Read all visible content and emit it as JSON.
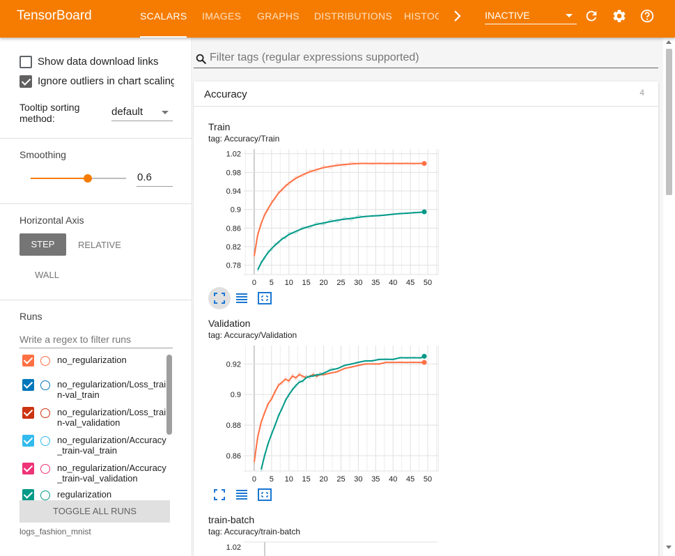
{
  "app": {
    "title": "TensorBoard"
  },
  "tabs": [
    {
      "label": "SCALARS",
      "active": true
    },
    {
      "label": "IMAGES"
    },
    {
      "label": "GRAPHS"
    },
    {
      "label": "DISTRIBUTIONS"
    },
    {
      "label": "HISTOG"
    }
  ],
  "status": {
    "value": "INACTIVE"
  },
  "icons": {
    "more_tabs": "chevron-right-icon",
    "reload": "reload-icon",
    "settings": "gear-icon",
    "help": "help-icon"
  },
  "sidebar": {
    "show_download": "Show data download links",
    "ignore_outliers": "Ignore outliers in chart scaling",
    "tooltip_label": "Tooltip sorting method:",
    "tooltip_value": "default",
    "smoothing_label": "Smoothing",
    "smoothing_value": "0.6",
    "smoothing_level": 0.6,
    "haxis_label": "Horizontal Axis",
    "haxis_step": "STEP",
    "haxis_relative": "RELATIVE",
    "haxis_wall": "WALL",
    "runs_label": "Runs",
    "runs_filter_placeholder": "Write a regex to filter runs",
    "runs": [
      {
        "name": "no_regularization",
        "color": "#ff7043"
      },
      {
        "name": "no_regularization/Loss_train-val_train",
        "color": "#0077bb"
      },
      {
        "name": "no_regularization/Loss_train-val_validation",
        "color": "#cc3311"
      },
      {
        "name": "no_regularization/Accuracy_train-val_train",
        "color": "#33bbee"
      },
      {
        "name": "no_regularization/Accuracy_train-val_validation",
        "color": "#ee3377"
      },
      {
        "name": "regularization",
        "color": "#009988"
      }
    ],
    "toggle_all": "TOGGLE ALL RUNS",
    "logdir": "logs_fashion_mnist"
  },
  "main": {
    "filter_placeholder": "Filter tags (regular expressions supported)",
    "card_title": "Accuracy",
    "card_count": "4"
  },
  "chart_data": [
    {
      "type": "line",
      "title": "Train",
      "tag": "tag: Accuracy/Train",
      "xticks": [
        "0",
        "5",
        "10",
        "15",
        "20",
        "25",
        "30",
        "35",
        "40",
        "45",
        "50"
      ],
      "yticks": [
        "1.02",
        "0.98",
        "0.94",
        "0.9",
        "0.86",
        "0.82",
        "0.78"
      ],
      "xlim": [
        -3,
        53
      ],
      "ylim": [
        0.76,
        1.03
      ],
      "series": [
        {
          "color": "#ff7043",
          "x": [
            0,
            1,
            2,
            3,
            4,
            5,
            6,
            7,
            8,
            9,
            10,
            12,
            14,
            16,
            18,
            20,
            22,
            24,
            26,
            28,
            30,
            32,
            34,
            36,
            38,
            40,
            42,
            44,
            46,
            48,
            49
          ],
          "y": [
            0.8,
            0.845,
            0.87,
            0.888,
            0.902,
            0.914,
            0.925,
            0.935,
            0.943,
            0.95,
            0.957,
            0.967,
            0.975,
            0.981,
            0.986,
            0.99,
            0.993,
            0.995,
            0.997,
            0.998,
            0.999,
            0.999,
            0.999,
            0.999,
            0.999,
            0.999,
            0.999,
            0.999,
            0.999,
            0.999,
            0.999
          ]
        },
        {
          "color": "#009988",
          "x": [
            1,
            2,
            3,
            4,
            5,
            6,
            7,
            8,
            9,
            10,
            12,
            14,
            16,
            18,
            20,
            22,
            24,
            26,
            28,
            30,
            32,
            34,
            36,
            38,
            40,
            42,
            44,
            46,
            48,
            49
          ],
          "y": [
            0.77,
            0.785,
            0.797,
            0.807,
            0.816,
            0.823,
            0.83,
            0.836,
            0.841,
            0.846,
            0.853,
            0.859,
            0.864,
            0.868,
            0.871,
            0.874,
            0.877,
            0.879,
            0.881,
            0.883,
            0.885,
            0.886,
            0.887,
            0.888,
            0.89,
            0.891,
            0.892,
            0.893,
            0.894,
            0.895
          ]
        }
      ]
    },
    {
      "type": "line",
      "title": "Validation",
      "tag": "tag: Accuracy/Validation",
      "xticks": [
        "0",
        "5",
        "10",
        "15",
        "20",
        "25",
        "30",
        "35",
        "40",
        "45",
        "50"
      ],
      "yticks": [
        "0.92",
        "0.9",
        "0.88",
        "0.86"
      ],
      "xlim": [
        -3,
        53
      ],
      "ylim": [
        0.85,
        0.932
      ],
      "series": [
        {
          "color": "#ff7043",
          "x": [
            0,
            1,
            2,
            3,
            4,
            5,
            6,
            7,
            8,
            9,
            10,
            11,
            12,
            13,
            14,
            15,
            16,
            17,
            18,
            19,
            20,
            22,
            24,
            26,
            28,
            30,
            32,
            34,
            36,
            38,
            40,
            42,
            44,
            46,
            48,
            49
          ],
          "y": [
            0.856,
            0.872,
            0.882,
            0.888,
            0.894,
            0.897,
            0.902,
            0.906,
            0.908,
            0.91,
            0.909,
            0.912,
            0.911,
            0.913,
            0.912,
            0.911,
            0.912,
            0.913,
            0.912,
            0.913,
            0.913,
            0.914,
            0.915,
            0.917,
            0.918,
            0.919,
            0.92,
            0.92,
            0.92,
            0.921,
            0.921,
            0.921,
            0.921,
            0.921,
            0.921,
            0.921
          ]
        },
        {
          "color": "#009988",
          "x": [
            2,
            3,
            4,
            5,
            6,
            7,
            8,
            9,
            10,
            11,
            12,
            13,
            14,
            15,
            16,
            17,
            18,
            19,
            20,
            22,
            24,
            26,
            28,
            30,
            32,
            34,
            36,
            38,
            40,
            42,
            44,
            46,
            48,
            49
          ],
          "y": [
            0.851,
            0.86,
            0.868,
            0.874,
            0.88,
            0.886,
            0.891,
            0.896,
            0.9,
            0.903,
            0.906,
            0.908,
            0.909,
            0.911,
            0.912,
            0.912,
            0.913,
            0.913,
            0.914,
            0.916,
            0.917,
            0.919,
            0.92,
            0.921,
            0.922,
            0.922,
            0.923,
            0.923,
            0.923,
            0.924,
            0.924,
            0.924,
            0.924,
            0.925
          ]
        }
      ]
    },
    {
      "type": "line",
      "title": "train-batch",
      "tag": "tag: Accuracy/train-batch",
      "yticks": [
        "1.02"
      ]
    }
  ]
}
